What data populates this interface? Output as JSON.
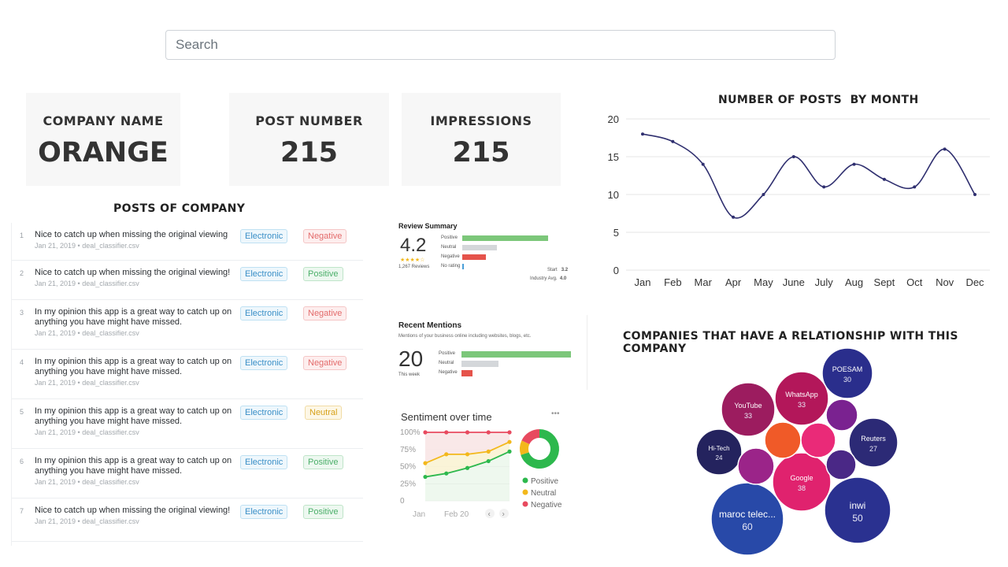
{
  "search": {
    "placeholder": "Search"
  },
  "kpis": {
    "company": {
      "label": "COMPANY NAME",
      "value": "ORANGE"
    },
    "posts": {
      "label": "POST NUMBER",
      "value": "215"
    },
    "impressions": {
      "label": "IMPRESSIONS",
      "value": "215"
    }
  },
  "posts_section": {
    "title": "POSTS OF COMPANY",
    "posts": [
      {
        "num": "1",
        "text": "Nice to catch up when missing the original viewing",
        "meta": "Jan 21, 2019 • deal_classifier.csv",
        "category": "Electronic",
        "sentiment": "Negative"
      },
      {
        "num": "2",
        "text": "Nice to catch up when missing the original viewing!",
        "meta": "Jan 21, 2019 • deal_classifier.csv",
        "category": "Electronic",
        "sentiment": "Positive"
      },
      {
        "num": "3",
        "text": "In my opinion this app is a great way to catch up on anything you have might have missed.",
        "meta": "Jan 21, 2019 • deal_classifier.csv",
        "category": "Electronic",
        "sentiment": "Negative"
      },
      {
        "num": "4",
        "text": "In my opinion this app is a great way to catch up on anything you have might have missed.",
        "meta": "Jan 21, 2019 • deal_classifier.csv",
        "category": "Electronic",
        "sentiment": "Negative"
      },
      {
        "num": "5",
        "text": "In my opinion this app is a great way to catch up on anything you have might have missed.",
        "meta": "Jan 21, 2019 • deal_classifier.csv",
        "category": "Electronic",
        "sentiment": "Neutral"
      },
      {
        "num": "6",
        "text": "In my opinion this app is a great way to catch up on anything you have might have missed.",
        "meta": "Jan 21, 2019 • deal_classifier.csv",
        "category": "Electronic",
        "sentiment": "Positive"
      },
      {
        "num": "7",
        "text": "Nice to catch up when missing the original viewing!",
        "meta": "Jan 21, 2019 • deal_classifier.csv",
        "category": "Electronic",
        "sentiment": "Positive"
      }
    ]
  },
  "review_summary": {
    "title": "Review Summary",
    "score": "4.2",
    "stars": "★★★★☆",
    "reviews": "1,267 Reviews",
    "rows": [
      {
        "label": "Positive",
        "value": 0.95,
        "color": "#7cc77a"
      },
      {
        "label": "Neutral",
        "value": 0.38,
        "color": "#d4d7da"
      },
      {
        "label": "Negative",
        "value": 0.26,
        "color": "#e5534b"
      },
      {
        "label": "No rating",
        "value": 0.02,
        "color": "#4a9fd8"
      }
    ],
    "start_label": "Start",
    "start_value": "3.2",
    "industry_label": "Industry Avg.",
    "industry_value": "4.0"
  },
  "recent_mentions": {
    "title": "Recent Mentions",
    "subtitle": "Mentions of your business online including websites, blogs, etc.",
    "count": "20",
    "period": "This week",
    "rows": [
      {
        "label": "Positive",
        "value": 1.0,
        "color": "#7cc77a"
      },
      {
        "label": "Neutral",
        "value": 0.34,
        "color": "#d4d7da"
      },
      {
        "label": "Negative",
        "value": 0.1,
        "color": "#e5534b"
      }
    ]
  },
  "sentiment_over_time": {
    "title": "Sentiment over time",
    "menu": "•••",
    "y_ticks": [
      "100%",
      "75%",
      "50%",
      "25%",
      "0"
    ],
    "x_ticks": [
      "Jan",
      "Feb 20"
    ],
    "legend": [
      {
        "label": "Positive",
        "color": "#2db84d"
      },
      {
        "label": "Neutral",
        "color": "#f3b81c"
      },
      {
        "label": "Negative",
        "color": "#e84a5f"
      }
    ],
    "series": {
      "negative": [
        100,
        100,
        100,
        100,
        100
      ],
      "neutral": [
        55,
        68,
        68,
        72,
        86
      ],
      "positive": [
        35,
        40,
        48,
        58,
        72
      ]
    },
    "donut": [
      {
        "label": "Positive",
        "value": 0.7,
        "color": "#2db84d"
      },
      {
        "label": "Neutral",
        "value": 0.12,
        "color": "#f3b81c"
      },
      {
        "label": "Negative",
        "value": 0.18,
        "color": "#e84a5f"
      }
    ]
  },
  "posts_by_month": {
    "title": "NUMBER OF POSTS  BY MONTH"
  },
  "relationships": {
    "title": "COMPANIES THAT HAVE A RELATIONSHIP WITH THIS COMPANY"
  },
  "chart_data": [
    {
      "type": "line",
      "title": "NUMBER OF POSTS  BY MONTH",
      "categories": [
        "Jan",
        "Feb",
        "Mar",
        "Apr",
        "May",
        "June",
        "July",
        "Aug",
        "Sept",
        "Oct",
        "Nov",
        "Dec"
      ],
      "values": [
        18,
        17,
        14,
        7,
        10,
        15,
        11,
        14,
        12,
        11,
        16,
        10
      ],
      "y_ticks": [
        0,
        5,
        10,
        15,
        20
      ],
      "ylim": [
        0,
        20
      ],
      "grid": true,
      "color": "#2f2f6f"
    },
    {
      "type": "bubble",
      "title": "COMPANIES THAT HAVE A RELATIONSHIP WITH THIS COMPANY",
      "bubbles": [
        {
          "name": "POESAM",
          "value": 30,
          "color": "#2a2e8c"
        },
        {
          "name": "WhatsApp",
          "value": 33,
          "color": "#b3175a"
        },
        {
          "name": "YouTube",
          "value": 33,
          "color": "#9c1c5f"
        },
        {
          "name": "Hi-Tech",
          "value": 24,
          "color": "#24235e"
        },
        {
          "name": "Reuters",
          "value": 27,
          "color": "#2c2a76"
        },
        {
          "name": "Google",
          "value": 38,
          "color": "#e0226e"
        },
        {
          "name": "inwi",
          "value": 50,
          "color": "#2a3190"
        },
        {
          "name": "maroc telec...",
          "value": 60,
          "color": "#2849a8"
        },
        {
          "name": "",
          "value": null,
          "color": "#f05a28"
        },
        {
          "name": "",
          "value": null,
          "color": "#ea2a78"
        },
        {
          "name": "",
          "value": null,
          "color": "#7a2290"
        },
        {
          "name": "",
          "value": null,
          "color": "#9b2489"
        },
        {
          "name": "",
          "value": null,
          "color": "#4a2886"
        }
      ]
    }
  ]
}
